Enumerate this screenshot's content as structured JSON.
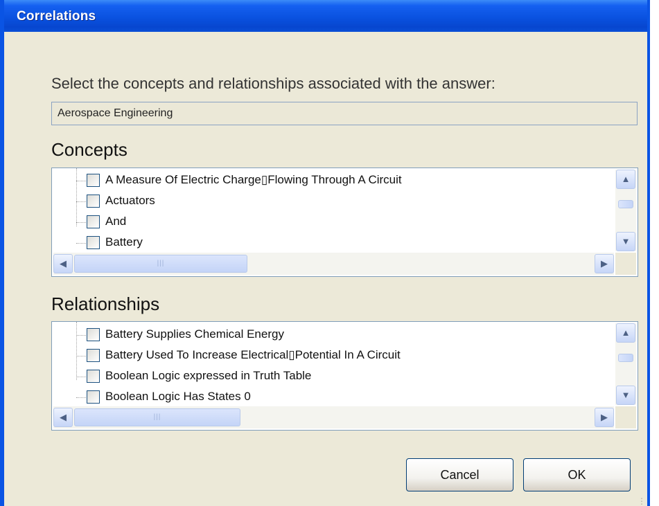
{
  "window": {
    "title": "Correlations"
  },
  "prompt": "Select the concepts and relationships associated with the answer:",
  "answer": "Aerospace Engineering",
  "concepts": {
    "heading": "Concepts",
    "items": [
      {
        "label": "A Measure Of Electric Charge▯Flowing Through A Circuit",
        "checked": false
      },
      {
        "label": "Actuators",
        "checked": false
      },
      {
        "label": "And",
        "checked": false
      },
      {
        "label": "Battery",
        "checked": false
      }
    ]
  },
  "relationships": {
    "heading": "Relationships",
    "items": [
      {
        "label": "Battery Supplies Chemical Energy",
        "checked": false
      },
      {
        "label": "Battery Used To Increase Electrical▯Potential In A Circuit",
        "checked": false
      },
      {
        "label": "Boolean Logic expressed in Truth Table",
        "checked": false
      },
      {
        "label": "Boolean Logic Has States 0",
        "checked": false
      }
    ]
  },
  "buttons": {
    "cancel": "Cancel",
    "ok": "OK"
  },
  "icons": {
    "scroll_up": "chevron-up-icon",
    "scroll_down": "chevron-down-icon",
    "scroll_left": "chevron-left-icon",
    "scroll_right": "chevron-right-icon",
    "checkbox": "checkbox-icon"
  },
  "colors": {
    "titlebar": "#0a52e0",
    "dialog_background": "#ece9d8",
    "list_border": "#7f9db9"
  }
}
